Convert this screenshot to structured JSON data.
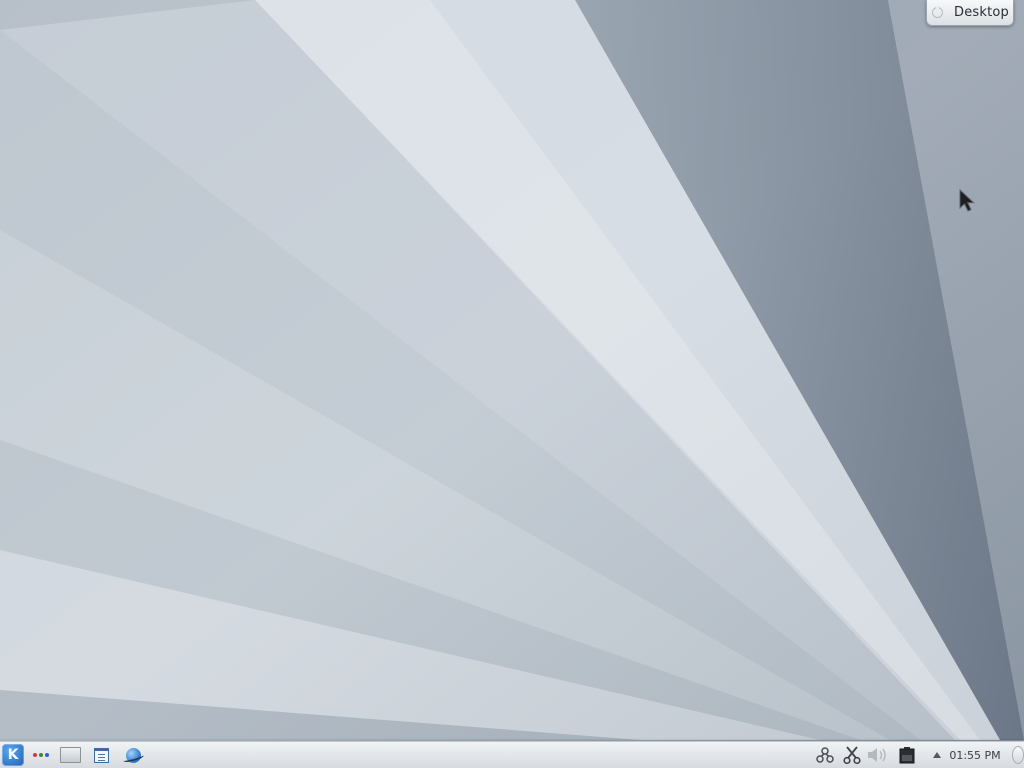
{
  "desktop": {
    "toolbox_label": "Desktop",
    "wallpaper": {
      "base_color": "#a9b4bf",
      "light_ray_color": "#e4e9ee",
      "dark_ray_color": "#6b7889"
    }
  },
  "panel": {
    "launchers": [
      {
        "name": "application-launcher",
        "icon": "kde-k-logo-icon"
      },
      {
        "name": "activity-manager",
        "icon": "colored-dots-icon"
      },
      {
        "name": "file-manager",
        "icon": "folder-icon"
      },
      {
        "name": "system-settings",
        "icon": "document-list-icon"
      },
      {
        "name": "web-browser",
        "icon": "globe-icon"
      }
    ],
    "activity_dot_colors": [
      "#d33a3a",
      "#3a8a3a",
      "#3a5ad3"
    ],
    "tray": {
      "icons": [
        "network-icon",
        "scissors-icon",
        "volume-icon",
        "battery-icon"
      ],
      "expand_icon": "triangle-up-icon",
      "clock": "01:55 PM"
    }
  },
  "accent_color": "#2a74c4"
}
